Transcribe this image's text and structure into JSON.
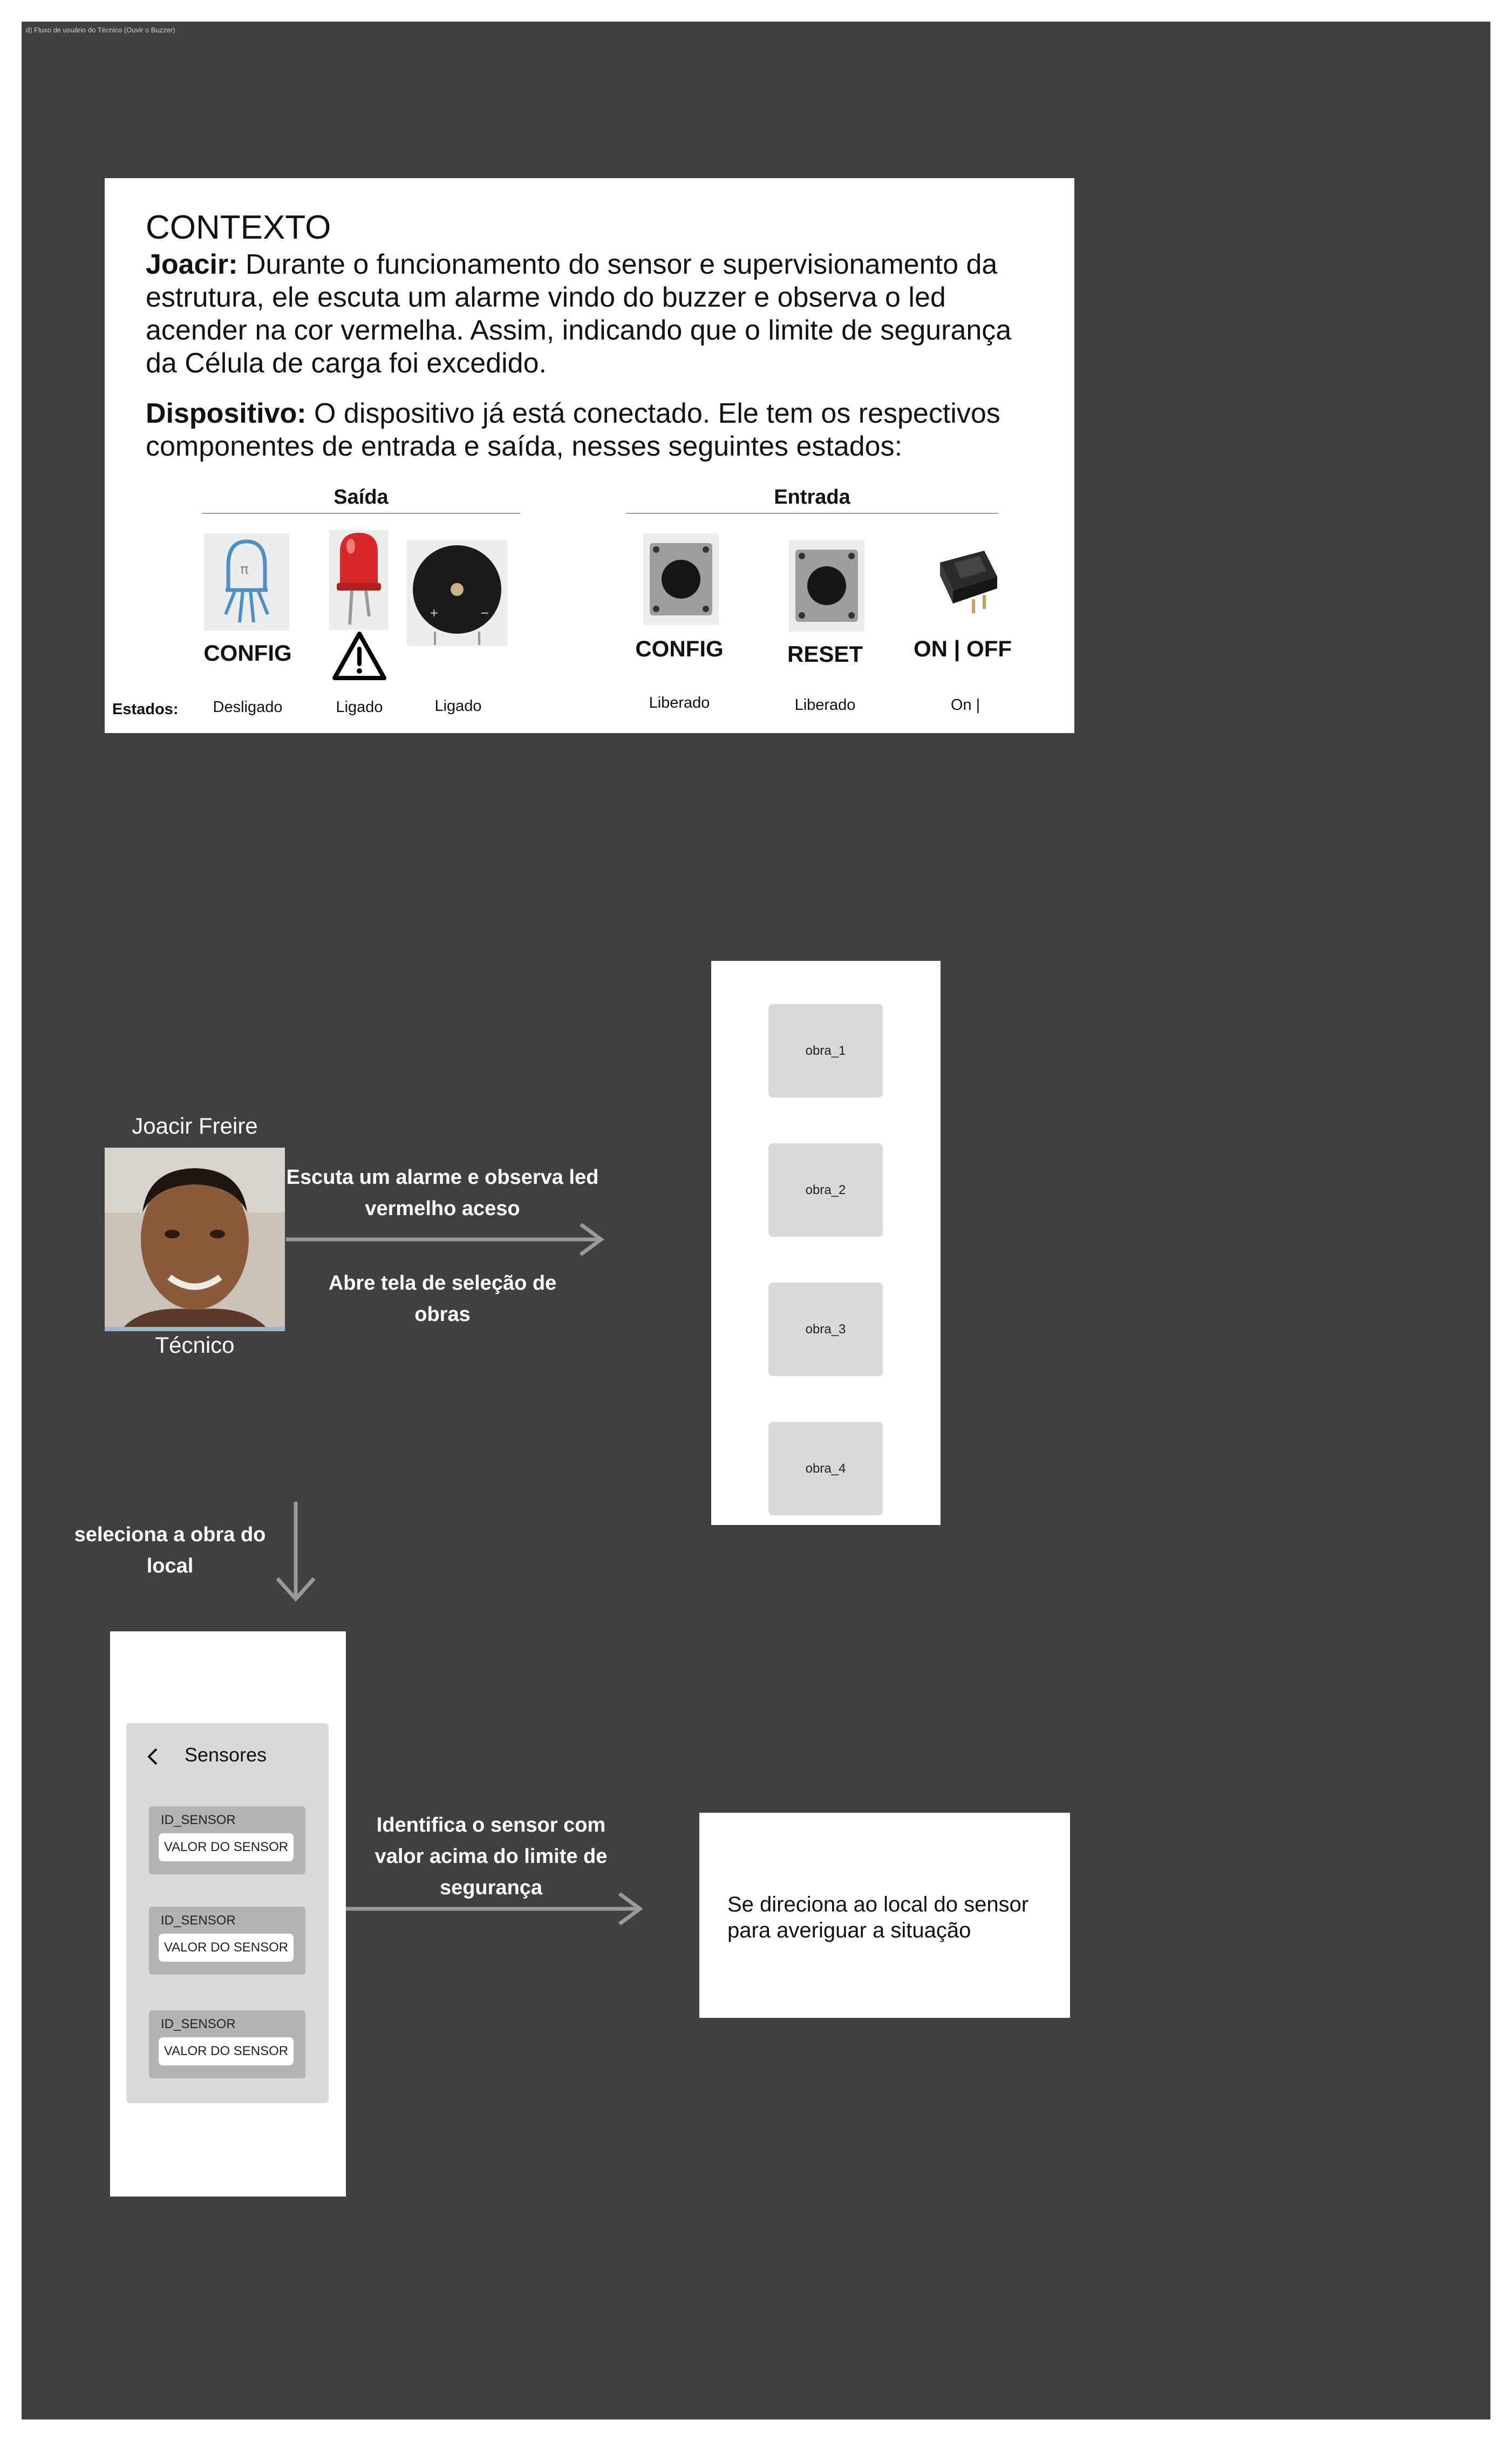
{
  "frame_title": "d) Fluxo de usuário do Técnico (Ouvir o Buzzer)",
  "context": {
    "title": "CONTEXTO",
    "p1_label": "Joacir:",
    "p1_text": " Durante o funcionamento do sensor e supervisionamento da estrutura, ele escuta um alarme vindo do buzzer e observa o led acender na cor vermelha. Assim, indicando que o limite de segurança da Célula de carga foi excedido.",
    "p2_label": "Dispositivo:",
    "p2_text": " O dispositivo já está conectado. Ele tem os respectivos componentes de entrada e saída, nesses seguintes estados:",
    "output_title": "Saída",
    "input_title": "Entrada",
    "states_label": "Estados:",
    "components": [
      {
        "label": "CONFIG",
        "state": "Desligado",
        "icon": "rgb-led-icon"
      },
      {
        "label": "",
        "state": "Ligado",
        "icon": "red-led-icon"
      },
      {
        "label": "",
        "state": "Ligado",
        "icon": "buzzer-icon"
      },
      {
        "label": "CONFIG",
        "state": "Liberado",
        "icon": "push-button-icon"
      },
      {
        "label": "RESET",
        "state": "Liberado",
        "icon": "push-button-icon"
      },
      {
        "label": "ON | OFF",
        "state": "On |",
        "icon": "rocker-switch-icon"
      }
    ]
  },
  "persona": {
    "name": "Joacir Freire",
    "role": "Técnico"
  },
  "flow": {
    "step1_top": "Escuta um alarme e observa led vermelho aceso",
    "step1_bottom": "Abre tela de seleção de obras",
    "step2": "seleciona a obra do local",
    "step3": "Identifica o sensor com valor acima do limite de segurança",
    "end": "Se direciona ao local do sensor para averiguar a situação"
  },
  "obras_screen": {
    "items": [
      "obra_1",
      "obra_2",
      "obra_3",
      "obra_4"
    ]
  },
  "sensors_screen": {
    "title": "Sensores",
    "cards": [
      {
        "id": "ID_SENSOR",
        "value": "VALOR DO SENSOR"
      },
      {
        "id": "ID_SENSOR",
        "value": "VALOR DO SENSOR"
      },
      {
        "id": "ID_SENSOR",
        "value": "VALOR DO SENSOR"
      }
    ]
  },
  "colors": {
    "background": "#404040",
    "arrow": "#9a9a9a",
    "led_red": "#d62828"
  }
}
